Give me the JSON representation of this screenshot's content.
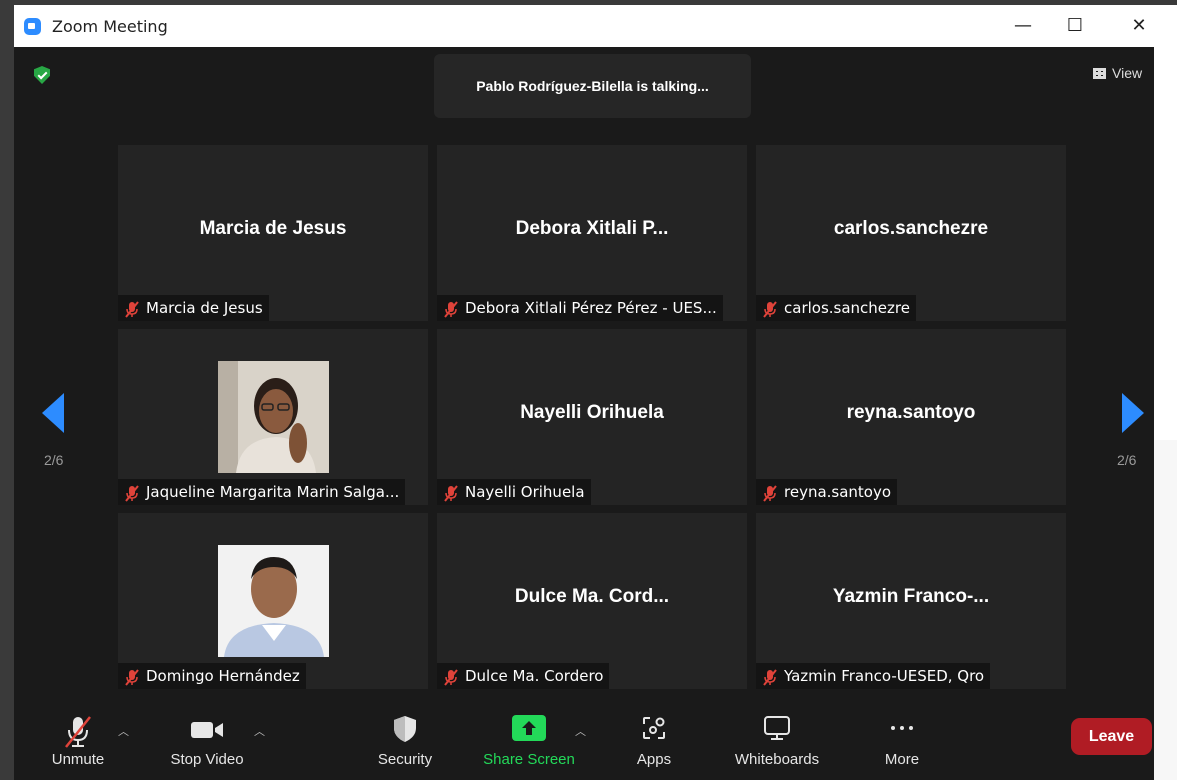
{
  "window": {
    "title": "Zoom Meeting",
    "minimize": "—",
    "maximize": "☐",
    "close": "✕"
  },
  "banner": {
    "talking": "Pablo Rodríguez-Bilella is talking..."
  },
  "view_button": "View",
  "pagination": {
    "left": "2/6",
    "right": "2/6"
  },
  "participants": [
    {
      "display": "Marcia de Jesus",
      "caption": "Marcia de Jesus",
      "photo": false
    },
    {
      "display": "Debora  Xitlali  P...",
      "caption": "Debora Xitlali Pérez Pérez - UES...",
      "photo": false
    },
    {
      "display": "carlos.sanchezre",
      "caption": "carlos.sanchezre",
      "photo": false
    },
    {
      "display": "",
      "caption": "Jaqueline Margarita Marin Salga...",
      "photo": true
    },
    {
      "display": "Nayelli Orihuela",
      "caption": "Nayelli Orihuela",
      "photo": false
    },
    {
      "display": "reyna.santoyo",
      "caption": "reyna.santoyo",
      "photo": false
    },
    {
      "display": "",
      "caption": "Domingo Hernández",
      "photo": true
    },
    {
      "display": "Dulce  Ma.  Cord...",
      "caption": "Dulce Ma. Cordero",
      "photo": false
    },
    {
      "display": "Yazmin  Franco-...",
      "caption": "Yazmin Franco-UESED, Qro",
      "photo": false
    }
  ],
  "toolbar": {
    "unmute": "Unmute",
    "stop_video": "Stop Video",
    "security": "Security",
    "share_screen": "Share Screen",
    "apps": "Apps",
    "whiteboards": "Whiteboards",
    "more": "More",
    "leave": "Leave"
  },
  "colors": {
    "accent": "#2d8cff",
    "share_green": "#23d959",
    "leave_red": "#b01c24",
    "muted_red": "#e0433a"
  }
}
